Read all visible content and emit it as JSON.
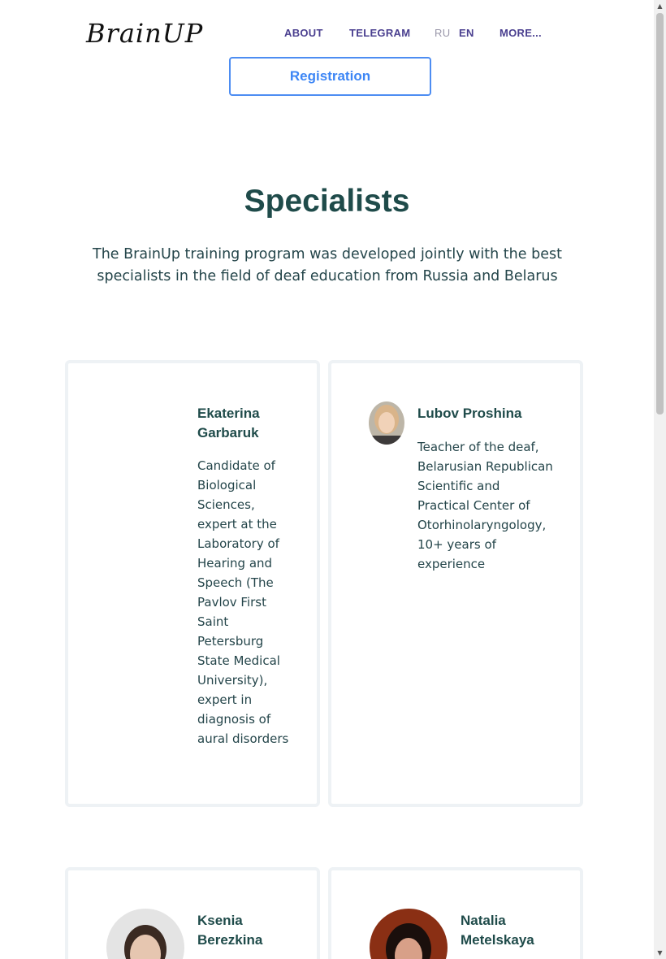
{
  "header": {
    "logo_text": "BrainUP",
    "nav": {
      "about": "ABOUT",
      "telegram": "TELEGRAM",
      "lang_ru": "RU",
      "lang_en": "EN",
      "more": "MORE..."
    },
    "registration_label": "Registration"
  },
  "specialists": {
    "title": "Specialists",
    "subtitle": "The BrainUp training program was developed jointly with the best specialists in the field of deaf education from Russia and Belarus",
    "cards": [
      {
        "name": "Ekaterina Garbaruk",
        "description": "Candidate of Biological Sciences, expert at the Laboratory of Hearing and Speech (The Pavlov First Saint Petersburg State Medical University), expert in diagnosis of aural disorders"
      },
      {
        "name": "Lubov Proshina",
        "description": "Teacher of the deaf, Belarusian Republican Scientific and Practical Center of Otorhinolaryngology, 10+ years of experience"
      },
      {
        "name": "Ksenia Berezkina",
        "description": ""
      },
      {
        "name": "Natalia Metelskaya",
        "description": ""
      }
    ]
  },
  "colors": {
    "heading": "#1f4b4a",
    "nav": "#4a3f8f",
    "accent": "#3d86f5",
    "card_border": "#eef2f5"
  }
}
